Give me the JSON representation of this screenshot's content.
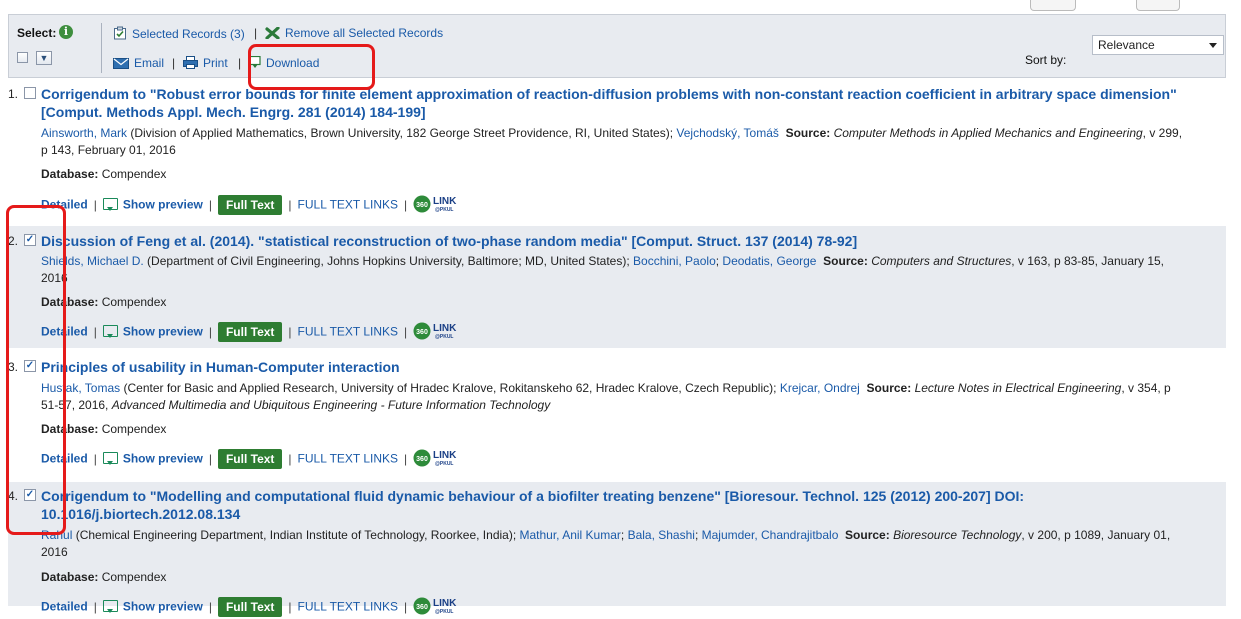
{
  "toolbar": {
    "select_label": "Select:",
    "info_icon": "i",
    "selected_records": "Selected Records (3)",
    "remove_all": "Remove all Selected Records",
    "email": "Email",
    "print": "Print",
    "download": "Download",
    "sort_label": "Sort by:",
    "sort_value": "Relevance"
  },
  "records": [
    {
      "num": "1.",
      "checked": false,
      "title": "Corrigendum to \"Robust error bounds for finite element approximation of reaction-diffusion problems with non-constant reaction coefficient in arbitrary space dimension\" [Comput. Methods Appl. Mech. Engrg. 281 (2014) 184-199]",
      "author1": "Ainsworth, Mark",
      "affil1": " (Division of Applied Mathematics, Brown University, 182 George Street Providence, RI, United States); ",
      "author2": "Vejchodský, Tomáš",
      "author3": "",
      "author4": "",
      "source_label": "Source:",
      "source_journal": "Computer Methods in Applied Mechanics and Engineering",
      "source_rest": ", v 299, p 143, February 01, 2016",
      "db_label": "Database:",
      "db_value": "Compendex"
    },
    {
      "num": "2.",
      "checked": true,
      "title": "Discussion of Feng et al. (2014). \"statistical reconstruction of two-phase random media\" [Comput. Struct. 137 (2014) 78-92]",
      "author1": "Shields, Michael D.",
      "affil1": " (Department of Civil Engineering, Johns Hopkins University, Baltimore; MD, United States); ",
      "author2": "Bocchini, Paolo",
      "author3": "Deodatis, George",
      "author4": "",
      "source_label": "Source:",
      "source_journal": "Computers and Structures",
      "source_rest": ", v 163, p 83-85, January 15, 2016",
      "db_label": "Database:",
      "db_value": "Compendex"
    },
    {
      "num": "3.",
      "checked": true,
      "title": "Principles of usability in Human-Computer interaction",
      "author1": "Hustak, Tomas",
      "affil1": " (Center for Basic and Applied Research, University of Hradec Kralove, Rokitanskeho 62, Hradec Kralove, Czech Republic); ",
      "author2": "Krejcar, Ondrej",
      "author3": "",
      "author4": "",
      "source_label": "Source:",
      "source_journal": "Lecture Notes in Electrical Engineering",
      "source_rest": ", v 354, p 51-57, 2016, ",
      "source_extra": "Advanced Multimedia and Ubiquitous Engineering - Future Information Technology",
      "db_label": "Database:",
      "db_value": "Compendex"
    },
    {
      "num": "4.",
      "checked": true,
      "title": "Corrigendum to \"Modelling and computational fluid dynamic behaviour of a biofilter treating benzene\" [Bioresour. Technol. 125 (2012) 200-207] DOI: 10.1016/j.biortech.2012.08.134",
      "author1": "Rahul",
      "affil1": " (Chemical Engineering Department, Indian Institute of Technology, Roorkee, India); ",
      "author2": "Mathur, Anil Kumar",
      "author3": "Bala, Shashi",
      "author4": "Majumder, Chandrajitbalo",
      "source_label": "Source:",
      "source_journal": "Bioresource Technology",
      "source_rest": ", v 200, p 1089, January 01, 2016",
      "db_label": "Database:",
      "db_value": "Compendex"
    }
  ],
  "actions": {
    "detailed": "Detailed",
    "show_preview": "Show preview",
    "full_text": "Full Text",
    "full_text_links": "FULL TEXT LINKS",
    "link_badge_num": "360",
    "link_badge_text": "LINK",
    "link_badge_sub": "@PKUL"
  },
  "colors": {
    "link": "#1a5aa8",
    "full_text_bg": "#2e7d32",
    "highlight": "#e51a1a",
    "alt_row": "#e8ebf0"
  }
}
